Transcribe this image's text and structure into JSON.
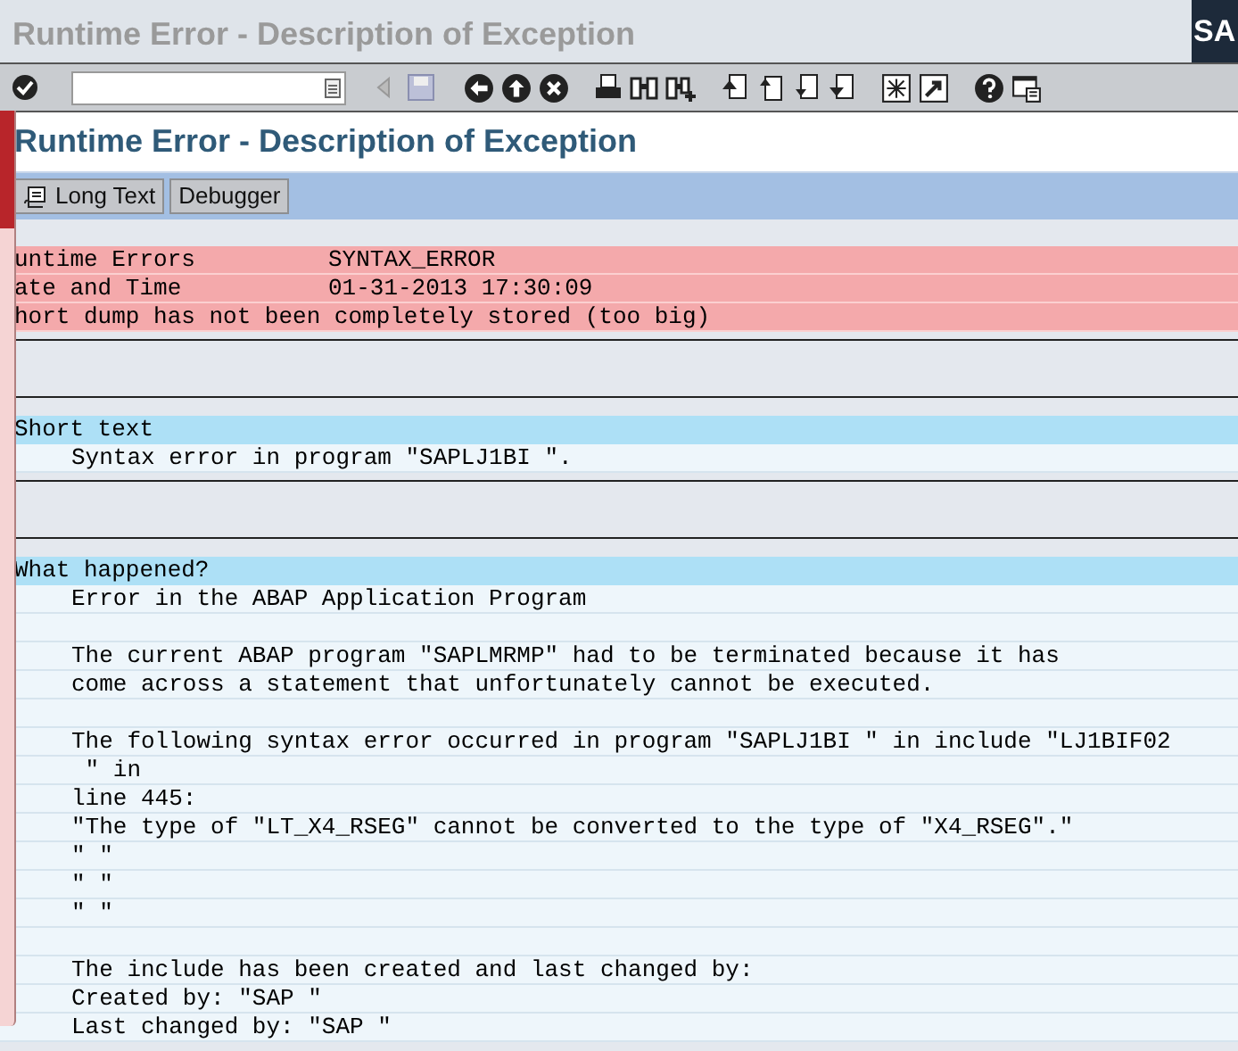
{
  "window": {
    "title": "Runtime Error - Description of Exception",
    "logo": "SA"
  },
  "screen_title": "Runtime Error - Description of Exception",
  "buttons": [
    {
      "label": "Long Text",
      "icon": true
    },
    {
      "label": "Debugger",
      "icon": false
    }
  ],
  "lines": [
    {
      "kind": "alert",
      "label": "untime Errors",
      "value": "SYNTAX_ERROR"
    },
    {
      "kind": "alert",
      "label": "ate and Time",
      "value": "01-31-2013 17:30:09"
    },
    {
      "kind": "alert",
      "label": "hort dump has not been completely stored (too big)"
    },
    {
      "kind": "separator"
    },
    {
      "kind": "heading",
      "label": "Short text"
    },
    {
      "kind": "text",
      "label": "Syntax error in program \"SAPLJ1BI \"."
    },
    {
      "kind": "separator"
    },
    {
      "kind": "heading",
      "label": "What happened?"
    },
    {
      "kind": "text",
      "label": "Error in the ABAP Application Program"
    },
    {
      "kind": "blank"
    },
    {
      "kind": "text",
      "label": "The current ABAP program \"SAPLMRMP\" had to be terminated because it has"
    },
    {
      "kind": "text",
      "label": "come across a statement that unfortunately cannot be executed."
    },
    {
      "kind": "blank"
    },
    {
      "kind": "text",
      "label": "The following syntax error occurred in program \"SAPLJ1BI \" in include \"LJ1BIF02"
    },
    {
      "kind": "text",
      "label": " \" in"
    },
    {
      "kind": "text",
      "label": "line 445:"
    },
    {
      "kind": "text",
      "label": "\"The type of \"LT_X4_RSEG\" cannot be converted to the type of \"X4_RSEG\".\""
    },
    {
      "kind": "text",
      "label": "\" \""
    },
    {
      "kind": "text",
      "label": "\" \""
    },
    {
      "kind": "text",
      "label": "\" \""
    },
    {
      "kind": "blank"
    },
    {
      "kind": "text",
      "label": "The include has been created and last changed by:"
    },
    {
      "kind": "text",
      "label": "Created by: \"SAP \""
    },
    {
      "kind": "text",
      "label": "Last changed by: \"SAP \""
    }
  ]
}
